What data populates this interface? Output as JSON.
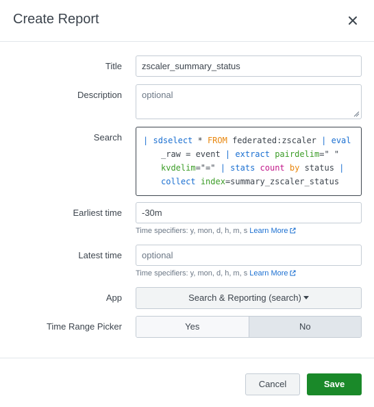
{
  "dialog": {
    "title": "Create Report",
    "close_icon": "close-icon"
  },
  "form": {
    "title": {
      "label": "Title",
      "value": "zscaler_summary_status"
    },
    "description": {
      "label": "Description",
      "placeholder": "optional"
    },
    "search": {
      "label": "Search",
      "query": "| sdselect * FROM federated:zscaler | eval _raw = event | extract pairdelim=\" \" kvdelim=\"=\" | stats count by status | collect index=summary_zscaler_status"
    },
    "earliest_time": {
      "label": "Earliest time",
      "value": "-30m",
      "help": "Time specifiers: y, mon, d, h, m, s",
      "learn_more": "Learn More"
    },
    "latest_time": {
      "label": "Latest time",
      "placeholder": "optional",
      "help": "Time specifiers: y, mon, d, h, m, s",
      "learn_more": "Learn More"
    },
    "app": {
      "label": "App",
      "selected": "Search & Reporting (search)"
    },
    "time_range_picker": {
      "label": "Time Range Picker",
      "options": [
        "Yes",
        "No"
      ],
      "selected": "No"
    }
  },
  "footer": {
    "cancel_label": "Cancel",
    "save_label": "Save"
  },
  "colors": {
    "save_green": "#1a8929",
    "link_blue": "#1a6fd1",
    "keyword_blue": "#1a6fd1",
    "keyword_orange": "#e8860c",
    "keyword_pink": "#c2188a",
    "keyword_green": "#3b9c26"
  }
}
